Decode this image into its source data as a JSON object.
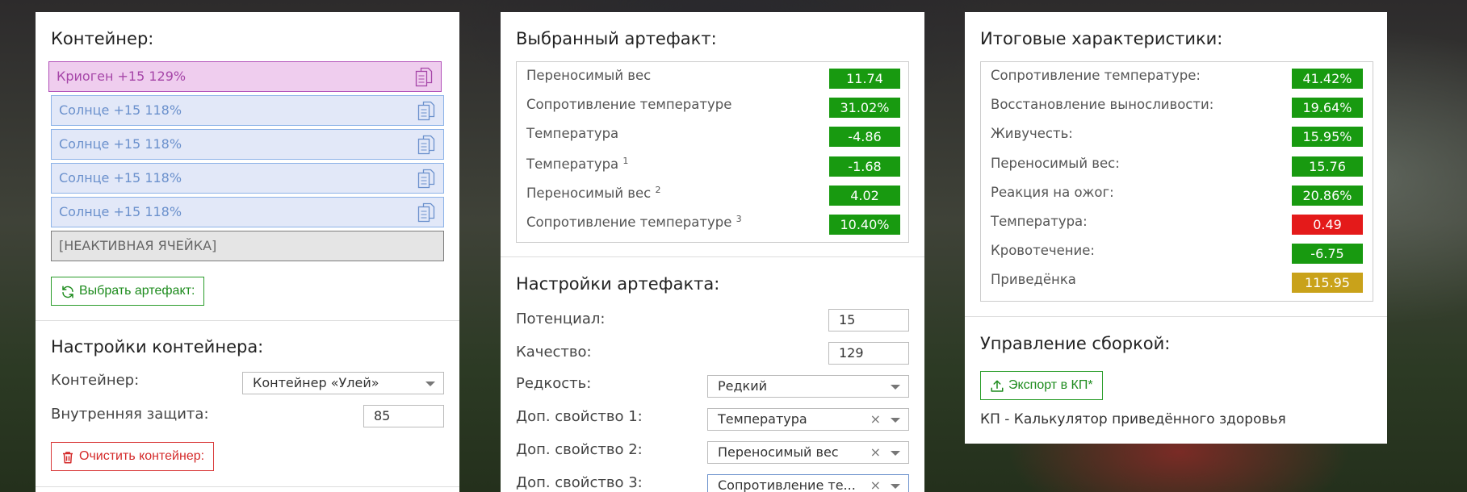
{
  "colors": {
    "good": "#189a10",
    "bad": "#e41a1a",
    "gold": "#c9a21a"
  },
  "container_panel": {
    "title": "Контейнер:",
    "slots": [
      {
        "label": "Криоген +15 129%",
        "state": "selected",
        "icon": "copy-icon"
      },
      {
        "label": "Солнце +15 118%",
        "state": "normal",
        "icon": "copy-icon"
      },
      {
        "label": "Солнце +15 118%",
        "state": "normal",
        "icon": "copy-icon"
      },
      {
        "label": "Солнце +15 118%",
        "state": "normal",
        "icon": "copy-icon"
      },
      {
        "label": "Солнце +15 118%",
        "state": "normal",
        "icon": "copy-icon"
      },
      {
        "label": "[НЕАКТИВНАЯ ЯЧЕЙКА]",
        "state": "inactive"
      }
    ],
    "choose_button": "Выбрать артефакт:",
    "choose_icon": "refresh-icon",
    "settings": {
      "title": "Настройки контейнера:",
      "container_label": "Контейнер:",
      "container_value": "Контейнер «Улей»",
      "protection_label": "Внутренняя защита:",
      "protection_value": "85",
      "clear_button": "Очистить контейнер:",
      "clear_icon": "trash-icon"
    }
  },
  "artifact_panel": {
    "title": "Выбранный артефакт:",
    "stats": [
      {
        "name": "Переносимый вес",
        "sup": "",
        "value": "11.74",
        "status": "good"
      },
      {
        "name": "Сопротивление температуре",
        "sup": "",
        "value": "31.02%",
        "status": "good"
      },
      {
        "name": "Температура",
        "sup": "",
        "value": "-4.86",
        "status": "good"
      },
      {
        "name": "Температура",
        "sup": "1",
        "value": "-1.68",
        "status": "good"
      },
      {
        "name": "Переносимый вес",
        "sup": "2",
        "value": "4.02",
        "status": "good"
      },
      {
        "name": "Сопротивление температуре",
        "sup": "3",
        "value": "10.40%",
        "status": "good"
      }
    ],
    "settings": {
      "title": "Настройки артефакта:",
      "potential_label": "Потенциал:",
      "potential_value": "15",
      "quality_label": "Качество:",
      "quality_value": "129",
      "rarity_label": "Редкость:",
      "rarity_value": "Редкий",
      "extra1_label": "Доп. свойство 1:",
      "extra1_value": "Температура",
      "extra2_label": "Доп. свойство 2:",
      "extra2_value": "Переносимый вес",
      "extra3_label": "Доп. свойство 3:",
      "extra3_value": "Сопротивление те...",
      "clear_glyph": "×"
    }
  },
  "totals_panel": {
    "title": "Итоговые характеристики:",
    "stats": [
      {
        "name": "Сопротивление температуре:",
        "value": "41.42%",
        "status": "good"
      },
      {
        "name": "Восстановление выносливости:",
        "value": "19.64%",
        "status": "good"
      },
      {
        "name": "Живучесть:",
        "value": "15.95%",
        "status": "good"
      },
      {
        "name": "Переносимый вес:",
        "value": "15.76",
        "status": "good"
      },
      {
        "name": "Реакция на ожог:",
        "value": "20.86%",
        "status": "good"
      },
      {
        "name": "Температура:",
        "value": "0.49",
        "status": "bad"
      },
      {
        "name": "Кровотечение:",
        "value": "-6.75",
        "status": "good"
      },
      {
        "name": "Приведёнка",
        "value": "115.95",
        "status": "gold"
      }
    ],
    "build": {
      "title": "Управление сборкой:",
      "export_button": "Экспорт в КП*",
      "export_icon": "upload-icon",
      "footnote": "КП - Калькулятор приведённого здоровья"
    }
  }
}
